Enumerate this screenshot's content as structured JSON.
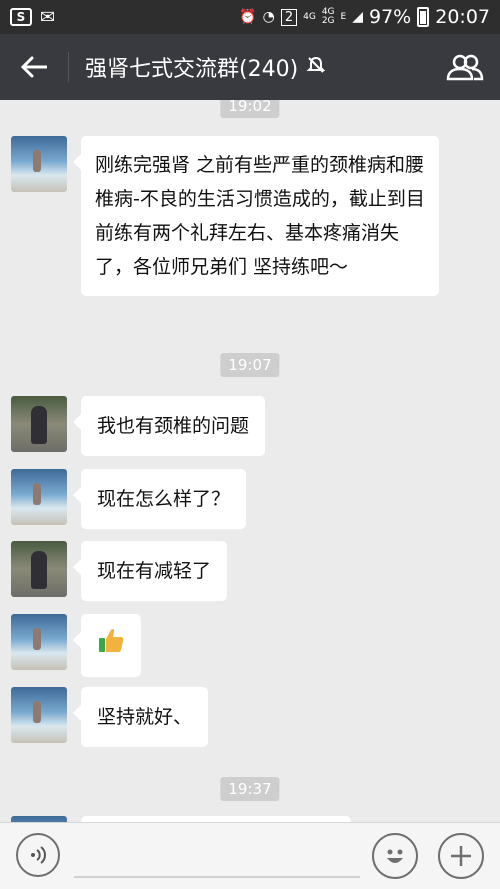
{
  "status_bar": {
    "signal_4g_top": "4G",
    "signal_4g": "4G",
    "signal_2g": "2G",
    "sim_badge": "2",
    "edge": "E",
    "battery": "97%",
    "time": "20:07"
  },
  "header": {
    "title": "强肾七式交流群(240)"
  },
  "messages": {
    "top_time": "19:02",
    "m1": "刚练完强肾 之前有些严重的颈椎病和腰椎病-不良的生活习惯造成的，截止到目前练有两个礼拜左右、基本疼痛消失了，各位师兄弟们 坚持练吧～",
    "time2": "19:07",
    "m2": "我也有颈椎的问题",
    "m3": "现在怎么样了？",
    "m4": "现在有减轻了",
    "m6": "坚持就好、",
    "time3": "19:37"
  }
}
